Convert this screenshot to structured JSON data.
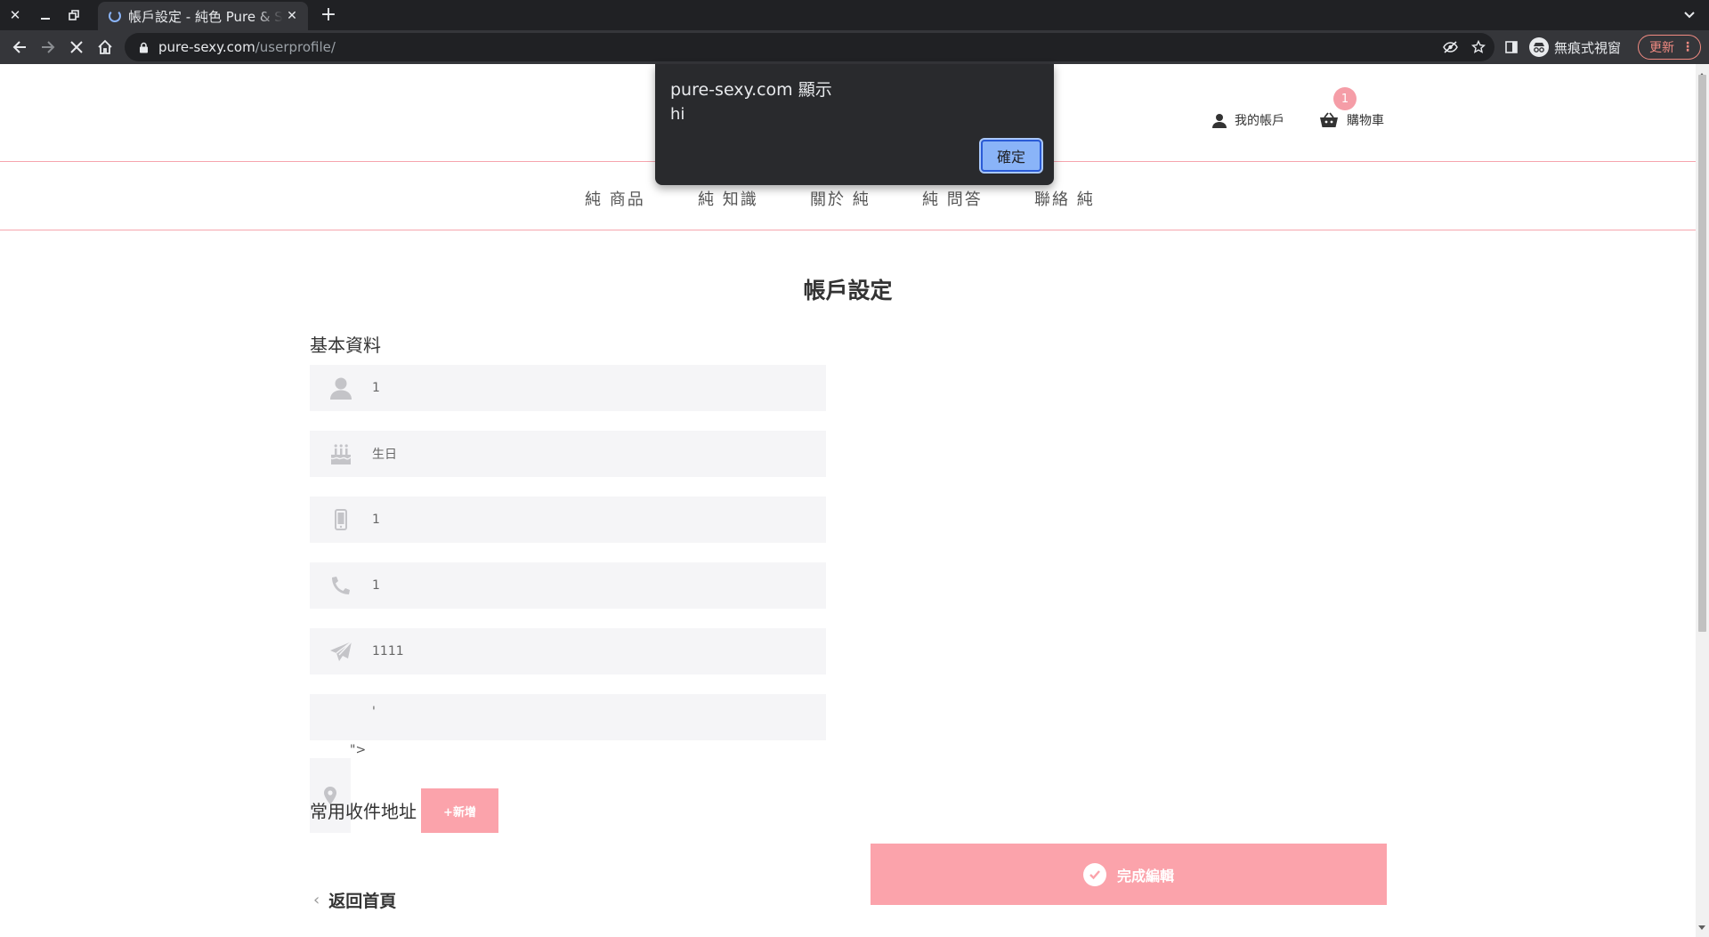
{
  "browser": {
    "tab_title": "帳戶設定 - 純色 Pure & Sexy",
    "url_host": "pure-sexy.com",
    "url_path": "/userprofile/",
    "incognito_label": "無痕式視窗",
    "update_label": "更新"
  },
  "header": {
    "account_label": "我的帳戶",
    "cart_label": "購物車",
    "cart_count": "1"
  },
  "nav": {
    "items": [
      "純 商品",
      "純 知識",
      "關於 純",
      "純 問答",
      "聯絡 純"
    ]
  },
  "page": {
    "title": "帳戶設定",
    "basic_info_title": "基本資料",
    "fields": [
      {
        "icon": "user-icon",
        "value": "1"
      },
      {
        "icon": "birthday-cake-icon",
        "value": "生日"
      },
      {
        "icon": "mobile-icon",
        "value": "1"
      },
      {
        "icon": "phone-icon",
        "value": "1"
      },
      {
        "icon": "paper-plane-icon",
        "value": "1111"
      },
      {
        "icon": "location-pin-icon",
        "value": "'"
      }
    ],
    "address_tail": "\">",
    "address_section_title": "常用收件地址",
    "add_button_label": "+新增",
    "done_button_label": "完成編輯",
    "back_link_label": "返回首頁"
  },
  "alert": {
    "origin": "pure-sexy.com 顯示",
    "message": "hi",
    "ok_label": "確定"
  },
  "colors": {
    "accent_pink": "#fba3ab",
    "divider_pink": "#f6a5ae",
    "field_bg": "#f5f5f7",
    "alert_ok": "#8ab4f8"
  }
}
